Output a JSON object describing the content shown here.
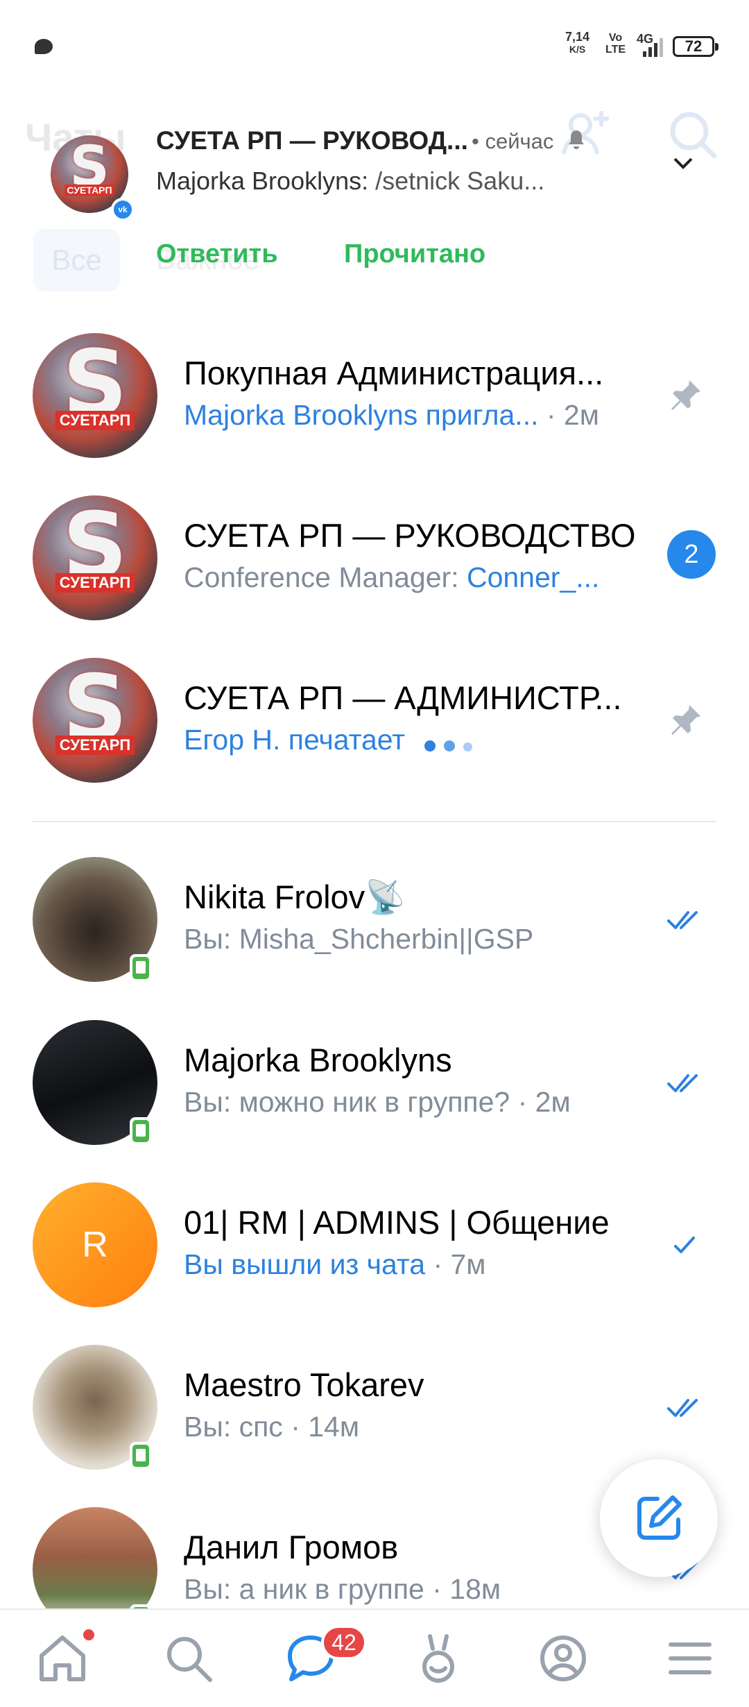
{
  "status_bar": {
    "speed_value": "7,14",
    "speed_unit": "K/S",
    "volte_top": "Vo",
    "volte_bottom": "LTE",
    "network": "4G",
    "battery": "72"
  },
  "header": {
    "title": "Чаты",
    "tabs": [
      "Все",
      "Важное"
    ]
  },
  "notification": {
    "title": "СУЕТА РП — РУКОВОД...",
    "time": "• сейчас",
    "sender": "Majorka Brooklyns:",
    "message": "/setnick Saku...",
    "avatar_label": "СУЕТАРП",
    "source_badge": "vk",
    "actions": {
      "reply": "Ответить",
      "mark_read": "Прочитано"
    }
  },
  "chats": [
    {
      "name": "Покупная Администрация...",
      "preview_highlight": "Majorka Brooklyns пригла...",
      "preview_text": "",
      "meta": " · 2м",
      "right": "pin-icon",
      "avatar_label": "СУЕТАРП"
    },
    {
      "name": "СУЕТА РП — РУКОВОДСТВО",
      "preview_text": "Conference Manager: ",
      "preview_highlight": "Conner_...",
      "meta": "",
      "right": "badge",
      "badge": "2",
      "avatar_label": "СУЕТАРП"
    },
    {
      "name": "СУЕТА РП — АДМИНИСТР...",
      "preview_highlight": "Егор Н. печатает",
      "preview_text": "",
      "meta": "",
      "right": "pin-icon",
      "avatar_label": "СУЕТАРП"
    },
    {
      "name": "Nikita Frolov📡",
      "preview_text": "Вы: Misha_Shcherbin||GSP",
      "meta": "",
      "right": "double-check-icon"
    },
    {
      "name": "Majorka Brooklyns",
      "preview_text": "Вы: можно ник в группе?",
      "meta": " · 2м",
      "right": "double-check-icon"
    },
    {
      "name": "01| RM | ADMINS | Общение",
      "preview_highlight": "Вы вышли из чата",
      "preview_text": "",
      "meta": " · 7м",
      "right": "check-icon",
      "avatar_letter": "R"
    },
    {
      "name": "Maestro Tokarev",
      "preview_text": "Вы: спс",
      "meta": " · 14м",
      "right": "double-check-icon"
    },
    {
      "name": "Данил Громов",
      "preview_text": "Вы: а ник в группе",
      "meta": " · 18м",
      "right": "double-check-icon"
    }
  ],
  "bottom_nav": {
    "items": [
      "home-icon",
      "search-icon",
      "messages-icon",
      "services-icon",
      "profile-icon",
      "menu-icon"
    ],
    "messages_badge": "42"
  },
  "colors": {
    "accent": "#2688eb",
    "link": "#2d81e0",
    "secondary_text": "#818c99",
    "action_green": "#2fba5a",
    "badge_red": "#e64646",
    "online_green": "#4bb34b"
  }
}
